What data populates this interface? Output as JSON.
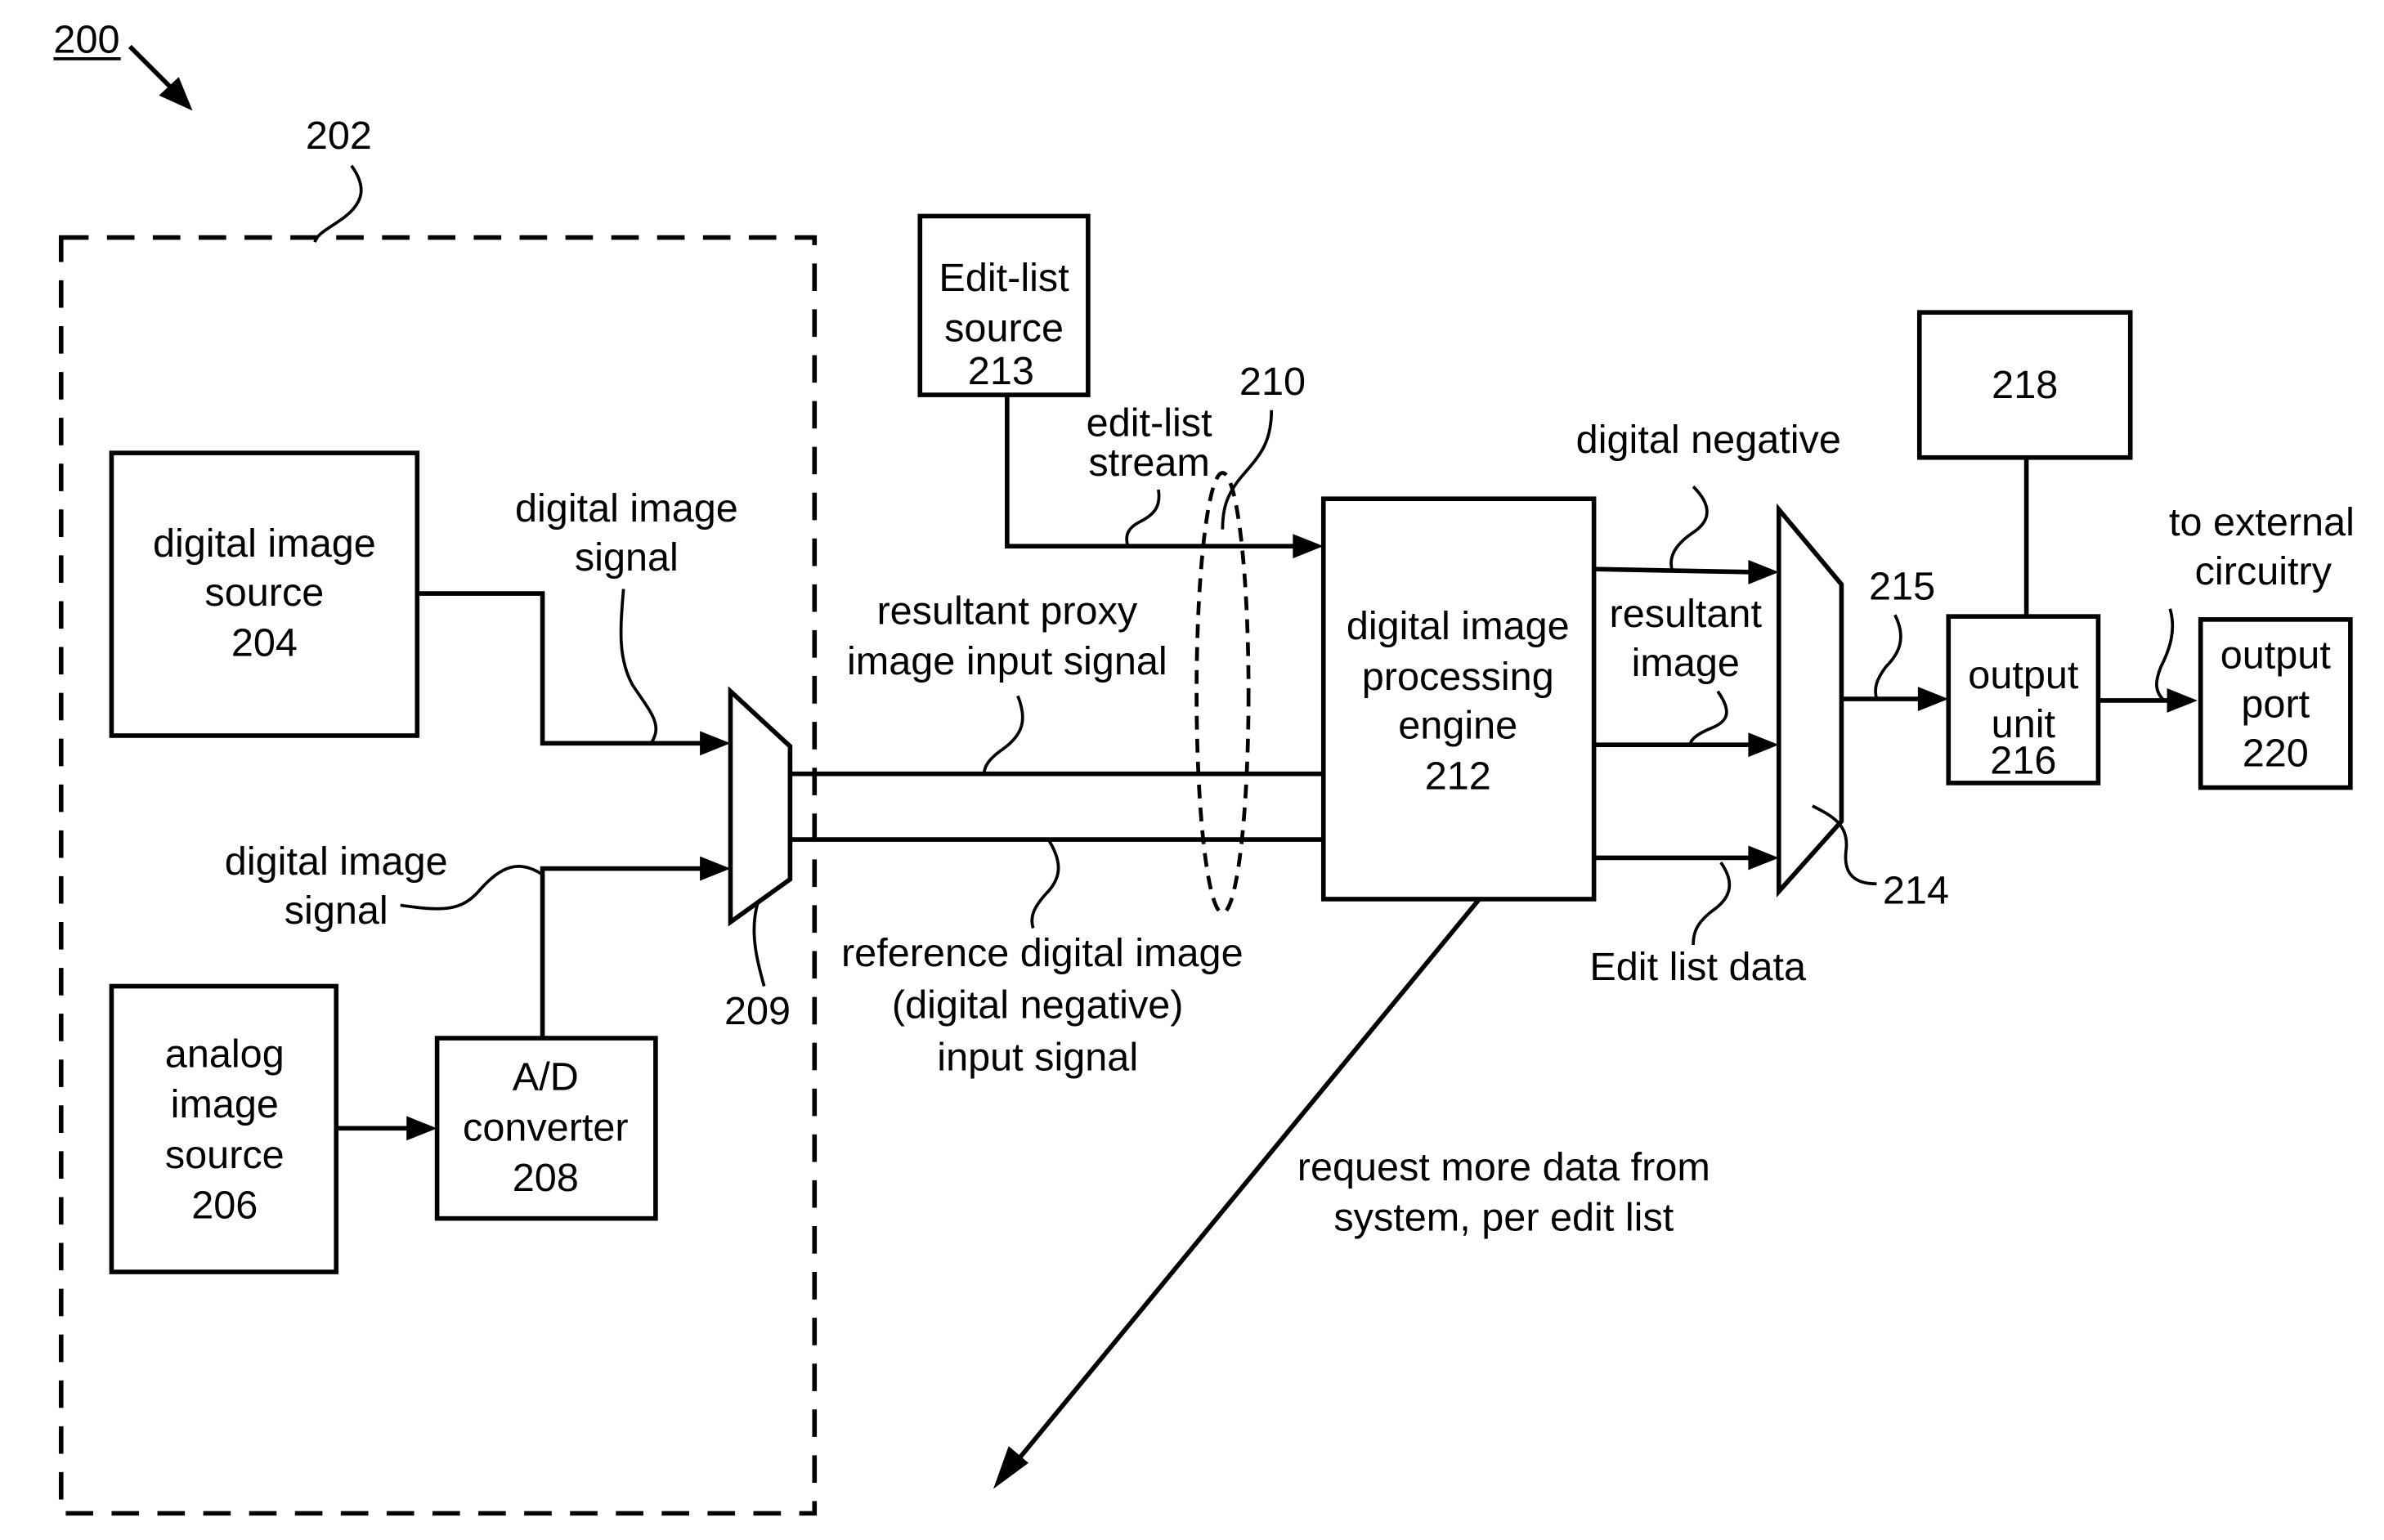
{
  "figure": {
    "ref": "200",
    "group_ref": "202"
  },
  "blocks": {
    "digital_image_source": {
      "lines": [
        "digital image",
        "source",
        "204"
      ]
    },
    "analog_image_source": {
      "lines": [
        "analog",
        "image",
        "source",
        "206"
      ]
    },
    "ad_converter": {
      "lines": [
        "A/D",
        "converter",
        "208"
      ]
    },
    "edit_list_source": {
      "lines": [
        "Edit-list",
        "source",
        "213"
      ]
    },
    "processing_engine": {
      "lines": [
        "digital image",
        "processing",
        "engine",
        "212"
      ]
    },
    "block_218": {
      "lines": [
        "218"
      ]
    },
    "output_unit": {
      "lines": [
        "output",
        "unit",
        "216"
      ]
    },
    "output_port": {
      "lines": [
        "output",
        "port",
        "220"
      ]
    }
  },
  "labels": {
    "mux_209": "209",
    "bundle_210": "210",
    "mux_214": "214",
    "line_215": "215",
    "digital_image_signal_top": [
      "digital image",
      "signal"
    ],
    "digital_image_signal_bottom": [
      "digital image",
      "signal"
    ],
    "edit_list_stream": [
      "edit-list",
      "stream"
    ],
    "resultant_proxy": [
      "resultant proxy",
      "image input signal"
    ],
    "reference_digital_image": [
      "reference digital image",
      "(digital negative)",
      "input signal"
    ],
    "digital_negative": "digital negative",
    "resultant_image": [
      "resultant",
      "image"
    ],
    "edit_list_data": "Edit list data",
    "to_external_circuitry": [
      "to external",
      "circuitry"
    ],
    "request_more_data": [
      "request more data from",
      "system, per edit list"
    ]
  }
}
